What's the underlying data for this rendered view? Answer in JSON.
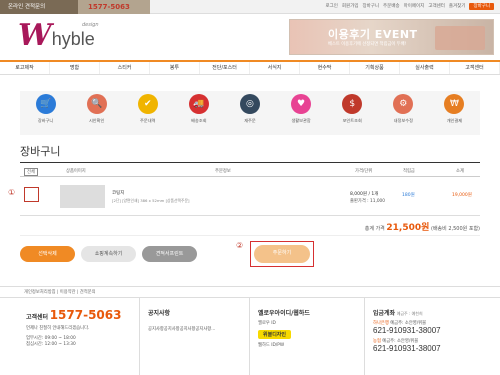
{
  "topbar": {
    "consult_label": "온라인 견적문의",
    "phone": "1577-5063",
    "links": [
      "로그인",
      "회원가입",
      "장바구니",
      "주문배송",
      "마이페이지",
      "고객센터",
      "즐겨찾기"
    ],
    "cart_badge": "장바구니"
  },
  "logo": {
    "mark": "W",
    "text": "hyble",
    "sub": "design"
  },
  "banner": {
    "title": "이용후기 EVENT",
    "subtitle": "베스트 이용후기에 선정되면 적립금이 두배!"
  },
  "nav": [
    "로고제작",
    "명함",
    "스티커",
    "봉투",
    "전단/포스터",
    "서식지",
    "현수막",
    "기획상품",
    "실사출력",
    "고객센터"
  ],
  "icons": [
    {
      "label": "장바구니",
      "icon": "cart-icon",
      "color": "#2b7bd8",
      "glyph": "🛒"
    },
    {
      "label": "시안확인",
      "icon": "magnifier-icon",
      "color": "#e17055",
      "glyph": "🔍"
    },
    {
      "label": "주문내역",
      "icon": "checklist-icon",
      "color": "#f0b400",
      "glyph": "✔"
    },
    {
      "label": "배송조회",
      "icon": "truck-icon",
      "color": "#d63031",
      "glyph": "🚚"
    },
    {
      "label": "재주문",
      "icon": "target-icon",
      "color": "#34495e",
      "glyph": "◎"
    },
    {
      "label": "생활보관함",
      "icon": "heart-icon",
      "color": "#e84393",
      "glyph": "♥"
    },
    {
      "label": "포인트조회",
      "icon": "moneybag-icon",
      "color": "#c0392b",
      "glyph": "$"
    },
    {
      "label": "내정보수정",
      "icon": "gear-icon",
      "color": "#e17055",
      "glyph": "⚙"
    },
    {
      "label": "개인결제",
      "icon": "wallet-icon",
      "color": "#e67e22",
      "glyph": "₩"
    }
  ],
  "page_title": "장바구니",
  "table": {
    "headers": {
      "all": "전체",
      "image": "상품이미지",
      "info": "주문정보",
      "price": "가격/단위",
      "points": "적립금",
      "subtotal": "소계"
    },
    "row": {
      "name": "코팅지",
      "options": "[2단] [양면인쇄] 386 x 52mm [상품선택주문]",
      "price_qty": "8,000원 / 1개",
      "order_total": "출판가격 : 11,000",
      "points": "180원",
      "subtotal": "19,000원"
    }
  },
  "total": {
    "label": "총계 가격",
    "amount": "21,500원",
    "note": "(배송비 2,500원 포함)"
  },
  "buttons": {
    "delete": "선택삭제",
    "shop": "쇼핑계속하기",
    "estimate": "견적서프린트",
    "order": "주문하기"
  },
  "markers": {
    "one": "①",
    "two": "②"
  },
  "footer": {
    "links": "개인정보처리방침  |  이용약관  |  견적문의",
    "cs_title": "고객센터",
    "cs_phone": "1577-5063",
    "cs_desc": "언제나 친절히 안내해드리겠습니다.",
    "cs_hours": "업무시간: 09:00 ~ 18:00",
    "cs_lunch": "점심시간: 12:00 ~ 13:30",
    "notice_title": "공지사항",
    "notice_item": "공지사항공지사항공지사항공지사항...",
    "kakao_title": "옐로우아이디/웹하드",
    "kakao_sub": "옐로우 ID",
    "kakao_badge": "위블디자인",
    "webhard": "웹하드 ID/PW",
    "bank_title": "입금계좌",
    "bank_sub": "예금주 : 예천희",
    "bank1_name": "하나은행",
    "bank1_holder": "예금주: 소안영/위블",
    "bank1_num": "621-910931-38007",
    "bank2_name": "농협",
    "bank2_holder": "예금주: 소안영/위블",
    "bank2_num": "621-910931-38007"
  }
}
